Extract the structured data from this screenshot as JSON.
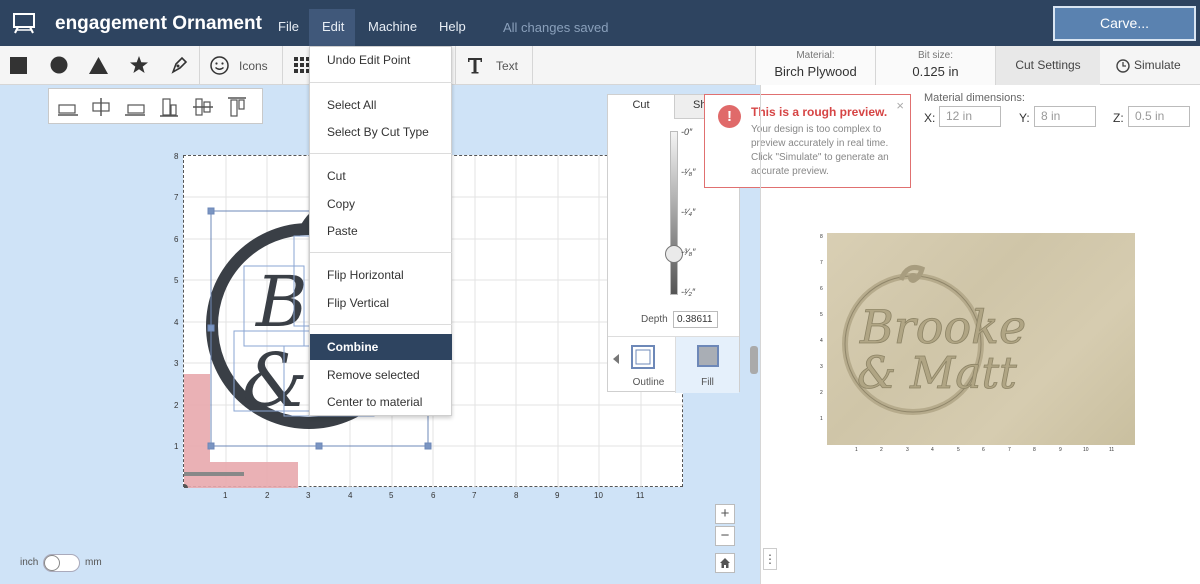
{
  "header": {
    "app_title": "engagement Ornament",
    "menu": {
      "file": "File",
      "edit": "Edit",
      "machine": "Machine",
      "help": "Help"
    },
    "save_status": "All changes saved",
    "carve_label": "Carve..."
  },
  "toolbar": {
    "icons_label": "Icons",
    "text_label": "Text",
    "material_label": "Material:",
    "material_value": "Birch Plywood",
    "bit_label": "Bit size:",
    "bit_value": "0.125 in",
    "cut_settings": "Cut Settings",
    "simulate": "Simulate"
  },
  "edit_menu": {
    "undo": "Undo Edit Point",
    "select_all": "Select All",
    "select_by_cut": "Select By Cut Type",
    "cut": "Cut",
    "copy": "Copy",
    "paste": "Paste",
    "flip_h": "Flip Horizontal",
    "flip_v": "Flip Vertical",
    "combine": "Combine",
    "remove_selected": "Remove selected",
    "center": "Center to material"
  },
  "cut_panel": {
    "tab_cut": "Cut",
    "tab_shape": "Sh",
    "depth_label": "Depth",
    "depth_value": "0.38611",
    "depth_position": 0.75,
    "outline_label": "Outline",
    "fill_label": "Fill"
  },
  "warning": {
    "title": "This is a rough preview.",
    "body": "Your design is too complex to preview accurately in real time. Click \"Simulate\" to generate an accurate preview.",
    "icon": "!",
    "close": "×"
  },
  "material_dims": {
    "label": "Material dimensions:",
    "x_label": "X:",
    "x_value": "12 in",
    "y_label": "Y:",
    "y_value": "8 in",
    "z_label": "Z:",
    "z_value": "0.5 in"
  },
  "preview_text": {
    "line1": "Brooke",
    "line2": "& Matt"
  },
  "canvas_text": {
    "line1": "Br",
    "line2": "&c"
  },
  "units": {
    "inch": "inch",
    "mm": "mm"
  },
  "zoom": {
    "in": "+",
    "out": "−"
  },
  "more": "⋮",
  "colors": {
    "header_bg": "#2e4460",
    "carve": "#5a82b0",
    "workspace": "#cfe3f7",
    "warning": "#d64545",
    "design": "#3a3f46"
  }
}
